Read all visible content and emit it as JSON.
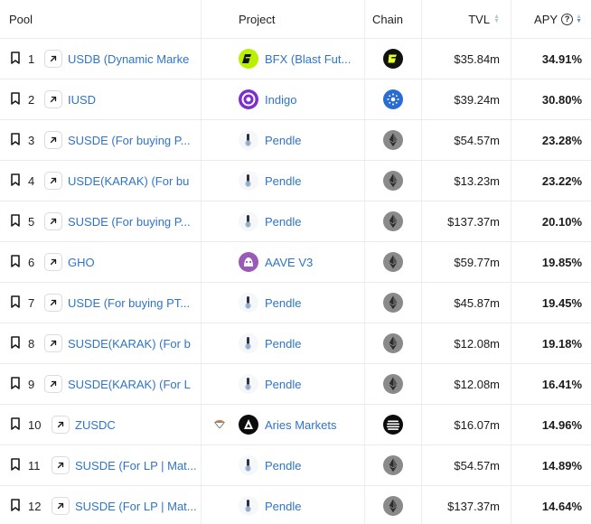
{
  "header": {
    "pool": "Pool",
    "project": "Project",
    "chain": "Chain",
    "tvl": "TVL",
    "apy": "APY",
    "help_glyph": "?"
  },
  "rows": [
    {
      "rank": "1",
      "pool": "USDB (Dynamic Marke",
      "project": "BFX (Blast Fut...",
      "project_icon": "bfx-icon",
      "chain_icon": "blast-icon",
      "tvl": "$35.84m",
      "apy": "34.91%"
    },
    {
      "rank": "2",
      "pool": "IUSD",
      "project": "Indigo",
      "project_icon": "indigo-icon",
      "chain_icon": "cardano-icon",
      "tvl": "$39.24m",
      "apy": "30.80%"
    },
    {
      "rank": "3",
      "pool": "SUSDE (For buying P...",
      "project": "Pendle",
      "project_icon": "pendle-icon",
      "chain_icon": "ethereum-icon",
      "tvl": "$54.57m",
      "apy": "23.28%"
    },
    {
      "rank": "4",
      "pool": "USDE(KARAK) (For bu",
      "project": "Pendle",
      "project_icon": "pendle-icon",
      "chain_icon": "ethereum-icon",
      "tvl": "$13.23m",
      "apy": "23.22%"
    },
    {
      "rank": "5",
      "pool": "SUSDE (For buying P...",
      "project": "Pendle",
      "project_icon": "pendle-icon",
      "chain_icon": "ethereum-icon",
      "tvl": "$137.37m",
      "apy": "20.10%"
    },
    {
      "rank": "6",
      "pool": "GHO",
      "project": "AAVE V3",
      "project_icon": "aave-icon",
      "chain_icon": "ethereum-icon",
      "tvl": "$59.77m",
      "apy": "19.85%"
    },
    {
      "rank": "7",
      "pool": "USDE (For buying PT...",
      "project": "Pendle",
      "project_icon": "pendle-icon",
      "chain_icon": "ethereum-icon",
      "tvl": "$45.87m",
      "apy": "19.45%"
    },
    {
      "rank": "8",
      "pool": "SUSDE(KARAK) (For b",
      "project": "Pendle",
      "project_icon": "pendle-icon",
      "chain_icon": "ethereum-icon",
      "tvl": "$12.08m",
      "apy": "19.18%"
    },
    {
      "rank": "9",
      "pool": "SUSDE(KARAK) (For L",
      "project": "Pendle",
      "project_icon": "pendle-icon",
      "chain_icon": "ethereum-icon",
      "tvl": "$12.08m",
      "apy": "16.41%"
    },
    {
      "rank": "10",
      "pool": "ZUSDC",
      "project": "Aries Markets",
      "project_icon": "aries-icon",
      "chain_icon": "aptos-icon",
      "tvl": "$16.07m",
      "apy": "14.96%"
    },
    {
      "rank": "11",
      "pool": "SUSDE (For LP | Mat...",
      "project": "Pendle",
      "project_icon": "pendle-icon",
      "chain_icon": "ethereum-icon",
      "tvl": "$54.57m",
      "apy": "14.89%"
    },
    {
      "rank": "12",
      "pool": "SUSDE (For LP | Mat...",
      "project": "Pendle",
      "project_icon": "pendle-icon",
      "chain_icon": "ethereum-icon",
      "tvl": "$137.37m",
      "apy": "14.64%"
    }
  ],
  "colors": {
    "link": "#2f74c8",
    "border": "#e9ecef",
    "bfx": "#b8f000",
    "indigo": "#7b2fd1",
    "aave": "#9a5ab8",
    "cardano": "#2a6cd6"
  }
}
